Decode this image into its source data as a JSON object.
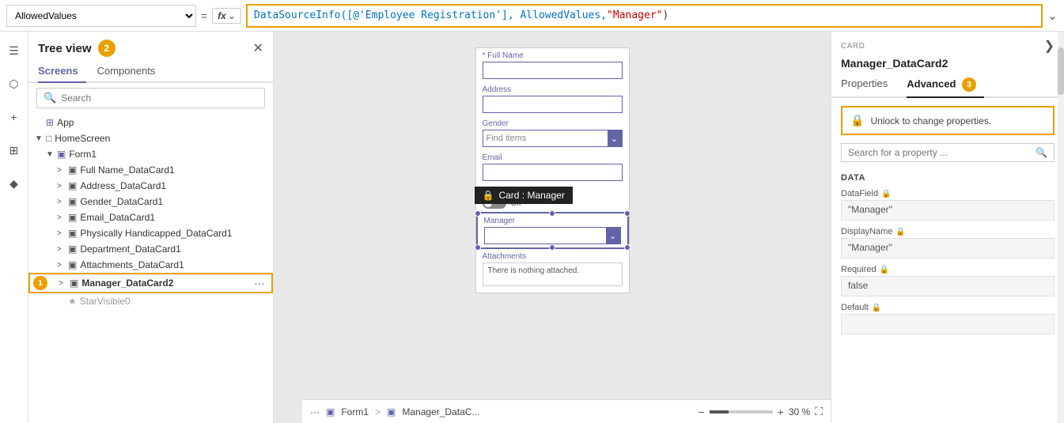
{
  "formulaBar": {
    "selectedProperty": "AllowedValues",
    "equalsSign": "=",
    "fxLabel": "fx",
    "formulaText": "DataSourceInfo([@'Employee Registration'], AllowedValues, \"Manager\")",
    "formulaTextBlue": "DataSourceInfo([@'Employee Registration'], AllowedValues, ",
    "formulaTextRed": "\"Manager\"",
    "formulaTextClose": ")",
    "chevronDown": "⌄"
  },
  "iconBar": {
    "icons": [
      "☰",
      "⬡",
      "+",
      "⊞",
      "⧫"
    ]
  },
  "treeView": {
    "title": "Tree view",
    "badgeNumber": "2",
    "closeIcon": "✕",
    "tabs": [
      {
        "label": "Screens",
        "active": true
      },
      {
        "label": "Components",
        "active": false
      }
    ],
    "searchPlaceholder": "Search",
    "nodes": [
      {
        "label": "App",
        "indent": 0,
        "expander": "",
        "icon": "app",
        "type": "app"
      },
      {
        "label": "HomeScreen",
        "indent": 0,
        "expander": "▼",
        "icon": "screen",
        "type": "screen"
      },
      {
        "label": "Form1",
        "indent": 1,
        "expander": "▼",
        "icon": "form",
        "type": "form"
      },
      {
        "label": "Full Name_DataCard1",
        "indent": 2,
        "expander": ">",
        "icon": "card",
        "type": "card"
      },
      {
        "label": "Address_DataCard1",
        "indent": 2,
        "expander": ">",
        "icon": "card",
        "type": "card"
      },
      {
        "label": "Gender_DataCard1",
        "indent": 2,
        "expander": ">",
        "icon": "card",
        "type": "card"
      },
      {
        "label": "Email_DataCard1",
        "indent": 2,
        "expander": ">",
        "icon": "card",
        "type": "card"
      },
      {
        "label": "Physically Handicapped_DataCard1",
        "indent": 2,
        "expander": ">",
        "icon": "card",
        "type": "card"
      },
      {
        "label": "Department_DataCard1",
        "indent": 2,
        "expander": ">",
        "icon": "card",
        "type": "card"
      },
      {
        "label": "Attachments_DataCard1",
        "indent": 2,
        "expander": ">",
        "icon": "card",
        "type": "card"
      },
      {
        "label": "Manager_DataCard2",
        "indent": 2,
        "expander": ">",
        "icon": "card",
        "type": "card",
        "selected": true,
        "badge": "1"
      },
      {
        "label": "StarVisible0",
        "indent": 2,
        "expander": "",
        "icon": "icon",
        "type": "icon"
      }
    ]
  },
  "canvas": {
    "form": {
      "fields": [
        {
          "label": "* Full Name",
          "type": "text",
          "value": ""
        },
        {
          "label": "Address",
          "type": "text",
          "value": ""
        },
        {
          "label": "Gender",
          "type": "dropdown",
          "value": "Find items"
        },
        {
          "label": "Email",
          "type": "text",
          "value": ""
        },
        {
          "label": "Physically Handicapped",
          "type": "toggle",
          "toggleValue": "Off"
        }
      ],
      "selectedCard": {
        "tooltip": "Card : Manager",
        "lockIcon": "🔒",
        "label": "Manager",
        "type": "dropdown",
        "value": ""
      },
      "attachments": {
        "label": "Attachments",
        "text": "There is nothing attached."
      }
    }
  },
  "statusBar": {
    "ellipsis": "···",
    "form1Label": "Form1",
    "managerCard": "Manager_DataC...",
    "zoomMinus": "−",
    "zoomPercent": "30 %",
    "zoomPlus": "+",
    "fitIcon": "⛶"
  },
  "propsPanel": {
    "cardLabel": "CARD",
    "chevron": "❯",
    "title": "Manager_DataCard2",
    "tabs": [
      {
        "label": "Properties",
        "active": false
      },
      {
        "label": "Advanced",
        "active": true,
        "badge": "3"
      }
    ],
    "unlockText": "Unlock to change properties.",
    "lockIcon": "🔒",
    "searchPlaceholder": "Search for a property ...",
    "searchIcon": "🔍",
    "sections": [
      {
        "label": "DATA",
        "fields": [
          {
            "label": "DataField",
            "value": "\"Manager\"",
            "locked": true
          },
          {
            "label": "DisplayName",
            "value": "\"Manager\"",
            "locked": true
          },
          {
            "label": "Required",
            "value": "false",
            "locked": true
          },
          {
            "label": "Default",
            "value": "",
            "locked": true
          }
        ]
      }
    ]
  }
}
